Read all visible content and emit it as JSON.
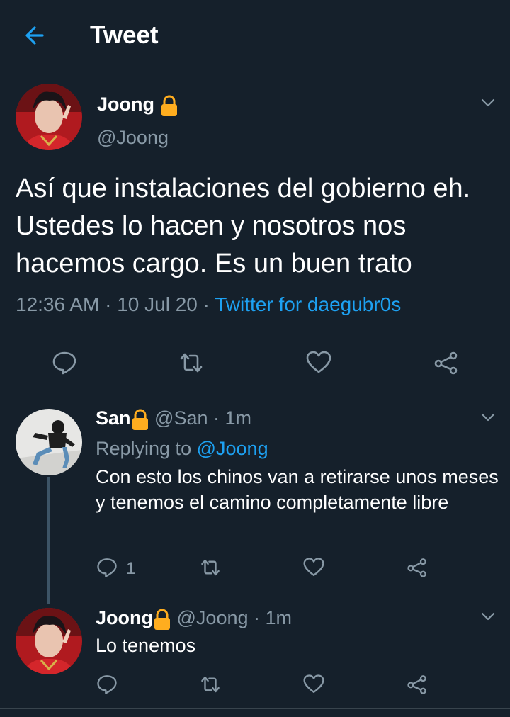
{
  "header": {
    "title": "Tweet",
    "back_icon": "arrow-left-icon"
  },
  "tweet": {
    "name": "Joong",
    "handle": "@Joong",
    "text": "Así que instalaciones del gobierno eh. Ustedes lo hacen y nosotros nos hacemos cargo. Es un buen trato",
    "time": "12:36 AM",
    "date": "10 Jul 20",
    "source": "Twitter for daegubr0s",
    "sep": "·"
  },
  "replies": [
    {
      "name": "San",
      "handle": "@San",
      "age": "1m",
      "replying_prefix": "Replying to",
      "replying_to": "@Joong",
      "text": "Con esto los chinos van a retirarse unos meses y tenemos el camino completamente libre",
      "reply_count": "1"
    },
    {
      "name": "Joong",
      "handle": "@Joong",
      "age": "1m",
      "text": "Lo tenemos"
    }
  ],
  "colors": {
    "background": "#15202b",
    "accent": "#1da1f2",
    "muted": "#8899a6",
    "lock": "#ffad1f",
    "divider": "#38444d"
  }
}
